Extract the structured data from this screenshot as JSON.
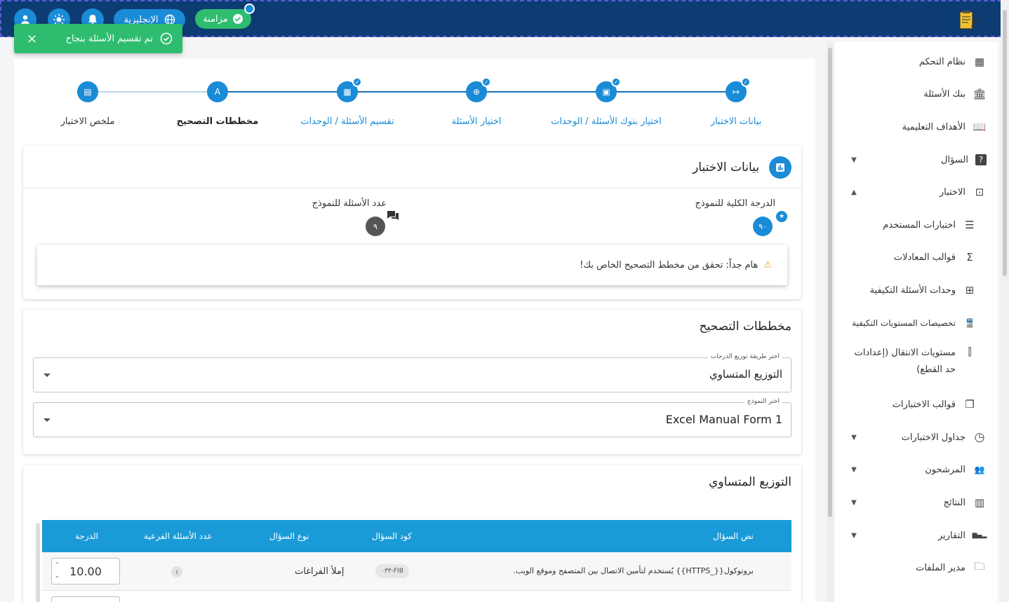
{
  "header": {
    "sync_label": "مزامنة",
    "language_label": "الإنجليزية"
  },
  "toast": {
    "message": "تم تقسيم الأسئلة بنجاح",
    "close": "×"
  },
  "sidebar": {
    "items": [
      {
        "label": "نظام التحكم",
        "icon": "dashboard-icon",
        "glyph": "▦"
      },
      {
        "label": "بنك الأسئلة",
        "icon": "bank-icon",
        "glyph": "🏛"
      },
      {
        "label": "الأهداف التعليمية",
        "icon": "book-icon",
        "glyph": "📖"
      },
      {
        "label": "السؤال",
        "icon": "question-icon",
        "glyph": "?",
        "arrow": "▼"
      },
      {
        "label": "الاختبار",
        "icon": "exam-icon",
        "glyph": "⊡",
        "arrow": "▲"
      },
      {
        "label": "اختبارات المستخدم",
        "icon": "list-icon",
        "glyph": "☰"
      },
      {
        "label": "قوالب المعادلات",
        "icon": "sigma-icon",
        "glyph": "Σ"
      },
      {
        "label": "وحدات الأسئلة التكيفية",
        "icon": "grid-icon",
        "glyph": "⊞"
      },
      {
        "label": "تخصيصات المستويات التكيفية",
        "icon": "train-icon",
        "glyph": "🚆"
      },
      {
        "label": "مستويات الانتقال (إعدادات حد القطع)",
        "icon": "bar-icon",
        "glyph": "⫿"
      },
      {
        "label": "قوالب الاختبارات",
        "icon": "copy-icon",
        "glyph": "❐"
      },
      {
        "label": "جداول الاختبارات",
        "icon": "clock-icon",
        "glyph": "◷",
        "arrow": "▼"
      },
      {
        "label": "المرشحون",
        "icon": "people-icon",
        "glyph": "👥",
        "arrow": "▼"
      },
      {
        "label": "النتائج",
        "icon": "chart-icon",
        "glyph": "▥",
        "arrow": "▼"
      },
      {
        "label": "التقارير",
        "icon": "stats-icon",
        "glyph": "▂▄▆",
        "arrow": "▼"
      },
      {
        "label": "مدير الملفات",
        "icon": "folder-icon",
        "glyph": "🗀"
      }
    ]
  },
  "stepper": {
    "steps": [
      {
        "label": "بيانات الاختبار",
        "glyph": "↦",
        "done": true
      },
      {
        "label": "اختيار بنوك الأسئلة / الوحدات",
        "glyph": "▣",
        "done": true
      },
      {
        "label": "اختيار الأسئلة",
        "glyph": "⊕",
        "done": true
      },
      {
        "label": "تقسيم الأسئلة / الوحدات",
        "glyph": "▦",
        "done": true
      },
      {
        "label": "مخططات التصحيح",
        "glyph": "A",
        "done": false,
        "active": true
      },
      {
        "label": "ملخص الاختبار",
        "glyph": "▤",
        "done": false
      }
    ],
    "check_glyph": "✓"
  },
  "exam_data": {
    "title": "بيانات الاختبار",
    "total_grade_label": "الدرجة الكلية للنموذج",
    "total_grade_value": "٩٠",
    "question_count_label": "عدد الأسئلة للنموذج",
    "question_count_value": "٩",
    "warning": "هام جداً: تحقق من مخطط التصحيح الخاص بك!"
  },
  "grading": {
    "title": "مخططات التصحيح",
    "distribution_legend": "اختر طريقة توزيع الدرجات",
    "distribution_value": "التوزيع المتساوي",
    "form_legend": "اختر النموذج",
    "form_value": "Excel Manual Form 1"
  },
  "equal": {
    "title": "التوزيع المتساوي",
    "columns": {
      "text": "نص السؤال",
      "code": "كود السؤال",
      "type": "نوع السؤال",
      "sub": "عدد الأسئلة الفرعية",
      "grade": "الدرجة"
    },
    "rows": [
      {
        "text": "بروتوكول{{_HTTPS}} يُستخدم لتأمين الاتصال بين المتصفح وموقع الويب.",
        "code": "٠٣٣-FIB",
        "type": "إملأ الفراغات",
        "sub": "١",
        "grade": "10.00"
      }
    ]
  },
  "colors": {
    "topbar": "#0d3c73",
    "accent": "#1a8bd6",
    "success": "#2ebd6e",
    "table_header": "#1a9bd8"
  }
}
